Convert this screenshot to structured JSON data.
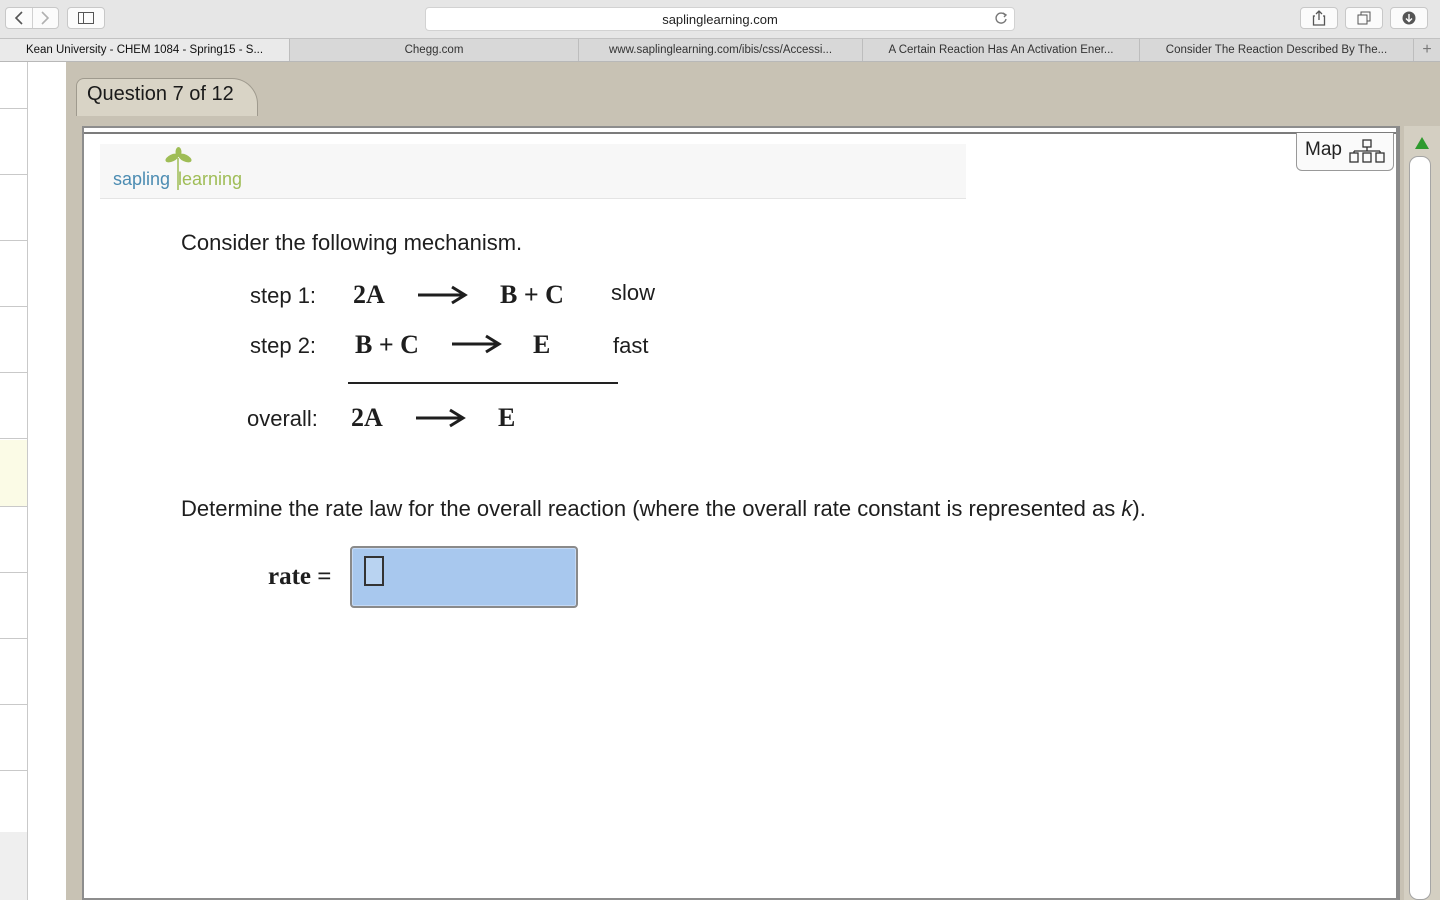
{
  "browser": {
    "url": "saplinglearning.com",
    "tabs": [
      "Kean University - CHEM 1084 - Spring15 - S...",
      "Chegg.com",
      "www.saplinglearning.com/ibis/css/Accessi...",
      "A Certain Reaction Has An Activation Ener...",
      "Consider The Reaction Described By The..."
    ],
    "new_tab": "+"
  },
  "question": {
    "tab_label": "Question 7 of 12",
    "map_label": "Map"
  },
  "logo": {
    "word1": "sapling",
    "word2": "learning",
    "brand_colors": {
      "blue": "#4c8cb2",
      "green": "#9fbd56"
    }
  },
  "problem": {
    "intro": "Consider the following mechanism.",
    "steps": [
      {
        "label": "step 1:",
        "reactants": "2A",
        "products": "B + C",
        "speed": "slow"
      },
      {
        "label": "step 2:",
        "reactants": "B + C",
        "products": "E",
        "speed": "fast"
      }
    ],
    "overall": {
      "label": "overall:",
      "reactants": "2A",
      "products": "E"
    },
    "prompt_before_k": "Determine the rate law for the overall reaction (where the overall rate constant is represented as ",
    "k": "k",
    "prompt_after_k": ").",
    "answer_label": "rate ="
  },
  "answer": {
    "value": ""
  },
  "colors": {
    "answer_fill": "#a8c8ee",
    "scroll_arrow": "#2e9a2e",
    "frame": "#c8c2b4"
  }
}
